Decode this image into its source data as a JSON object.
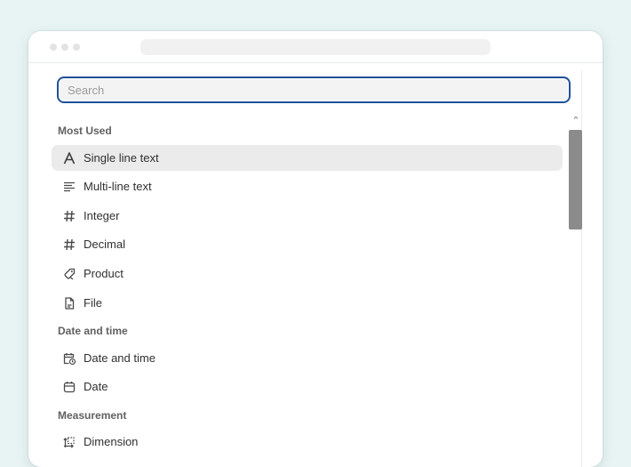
{
  "search": {
    "placeholder": "Search"
  },
  "sections": {
    "most_used": "Most Used",
    "date_and_time": "Date and time",
    "measurement": "Measurement"
  },
  "items": {
    "single_line_text": "Single line text",
    "multi_line_text": "Multi-line text",
    "integer": "Integer",
    "decimal": "Decimal",
    "product": "Product",
    "file": "File",
    "date_and_time": "Date and time",
    "date": "Date",
    "dimension": "Dimension"
  },
  "state": {
    "selected_item": "Single line text"
  }
}
